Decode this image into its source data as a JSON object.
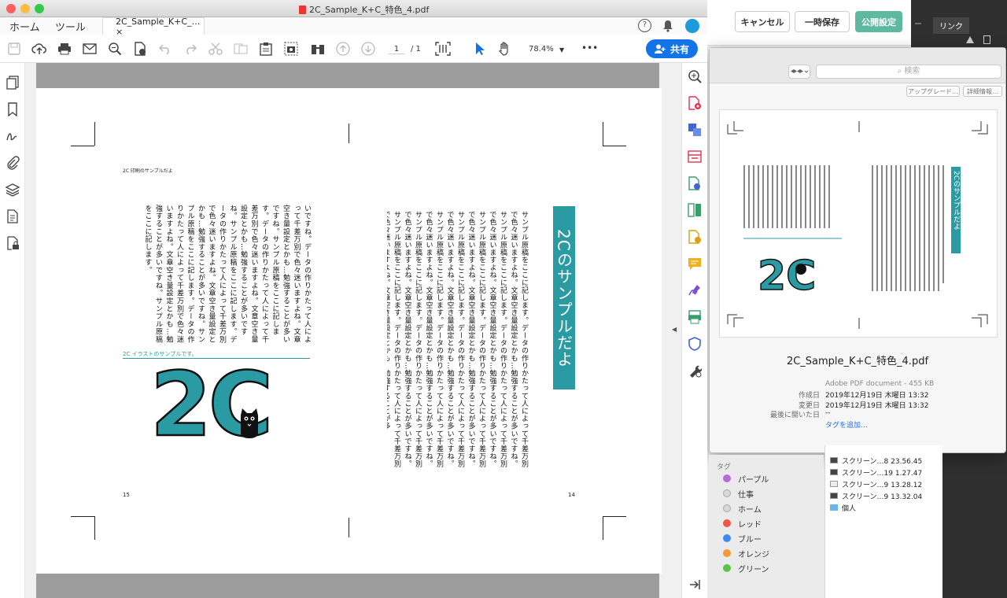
{
  "window": {
    "title": "2C_Sample_K+C_特色_4.pdf"
  },
  "nav": {
    "home": "ホーム",
    "tools": "ツール"
  },
  "tab": {
    "label": "2C_Sample_K+C_… ×"
  },
  "toolbar": {
    "page_current": "1",
    "page_total": "/ 1",
    "zoom": "78.4%",
    "share_label": "共有",
    "more": "•••"
  },
  "right_page": {
    "heading": "2Cのサンプルだよ",
    "body": "サンプル原稿をここに記します。データの作りかたって人によって千差万別で色々迷いますよね。文章空き量設定とかも…勉強することが多いですね。サンプル原稿をここに記します。データの作りかたって人によって千差万別で色々迷いますよね。文章空き量設定とかも…勉強することが多いですね。サンプル原稿をここに記します。データの作りかたって人によって千差万別で色々迷いますよね。文章空き量設定とかも…勉強することが多いですね。サンプル原稿をここに記します。データの作りかたって人によって千差万別で色々迷いますよね。文章空き量設定とかも…勉強することが多いですね。サンプル原稿をここに記します。データの作りかたって人によって千差万別で色々迷いますよね。文章空き量設定とかも…勉強することが多いですね。サンプル原稿をここに記します。データの作りかたって人によって千差万別で色々迷いますよね。文章空き量設定とかも…勉強することが多いですね。サンプル原稿をここに記します。データの作りかたって人によって千差万別で色々迷いますよね。文章空き量設定とかも…勉強することが多",
    "page_number": "14"
  },
  "left_page": {
    "running_head": "2C 印刷のサンプルだよ",
    "body": "いですね。データの作りかたって人によって千差万別で色々迷いますよね。文章空き量設定とかも…勉強することが多いですね。サンプル原稿をここに記します。データの作りかたって人によって千差万別で色々迷いますよね。文章空き量設定とかも…勉強することが多いですね。サンプル原稿をここに記します。データの作りかたって人によって千差万別で色々迷いますよね。文章空き量設定とかも…勉強することが多いですね。サンプル原稿をここに記します。データの作りかたって人によって千差万別で色々迷いますよね。文章空き量設定とかも…勉強することが多いですね。サンプル原稿をここに記します。",
    "caption": "2C イラストのサンプルです。",
    "illustration_text": "2C",
    "page_number": "15"
  },
  "web": {
    "cancel": "キャンセル",
    "draft": "一時保存",
    "publish": "公開設定",
    "panel_tab": "リンク",
    "panel_tab_prev": "ー"
  },
  "finder": {
    "search_placeholder": "検索",
    "upgrade": "アップグレード…",
    "details": "詳細情報…",
    "file_name": "2C_Sample_K+C_特色_4.pdf",
    "kind": "Adobe PDF document - 455 KB",
    "meta": [
      {
        "key": "作成日",
        "value": "2019年12月19日 木曜日 13:32"
      },
      {
        "key": "変更日",
        "value": "2019年12月19日 木曜日 13:32"
      },
      {
        "key": "最後に開いた日",
        "value": "--"
      }
    ],
    "add_tags": "タグを追加…",
    "tags_header": "タグ",
    "tags": [
      {
        "label": "パープル",
        "color": "#b86ad9"
      },
      {
        "label": "仕事",
        "color": "#d8d8d8"
      },
      {
        "label": "ホーム",
        "color": "#d8d8d8"
      },
      {
        "label": "レッド",
        "color": "#f2564a"
      },
      {
        "label": "ブルー",
        "color": "#3d8bf2"
      },
      {
        "label": "オレンジ",
        "color": "#f29a38"
      },
      {
        "label": "グリーン",
        "color": "#5cc34a"
      }
    ],
    "files": [
      "スクリーン…8 23.56.45",
      "スクリーン…19 1.27.47",
      "スクリーン…9 13.28.12",
      "スクリーン…9 13.32.04",
      "個人"
    ]
  },
  "colors": {
    "accent": "#2a9aa3",
    "share": "#1473e6",
    "publish": "#5fb9a0"
  }
}
